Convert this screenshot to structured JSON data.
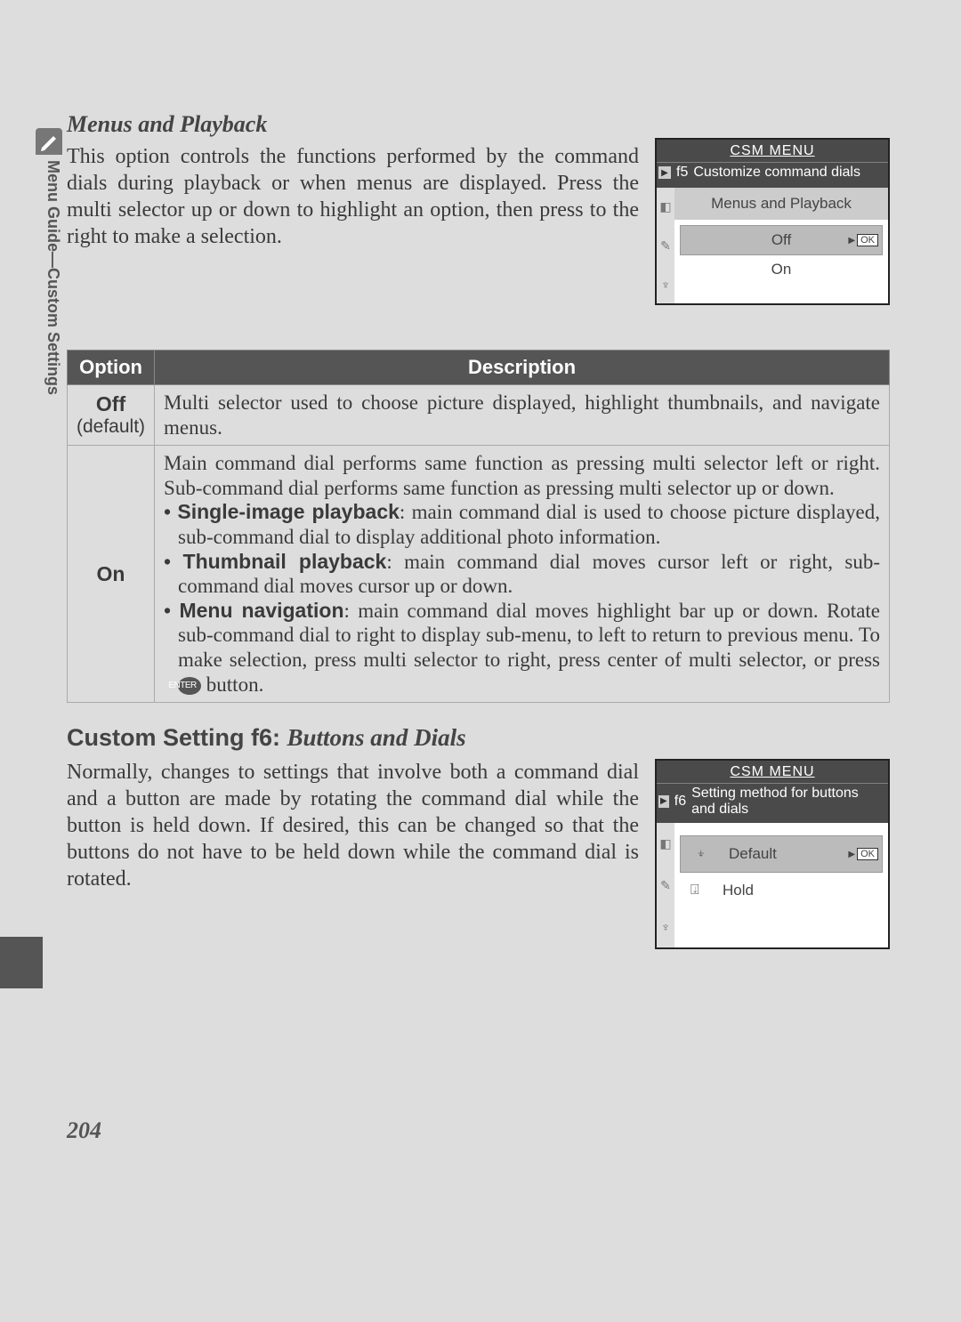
{
  "side_tab": {
    "label": "Menu Guide—Custom Settings"
  },
  "section1": {
    "subheading": "Menus and Playback",
    "body": "This option controls the functions performed by the command dials during playback or when menus are displayed.  Press the multi selector up or down to highlight an option, then press to the right to make a selection."
  },
  "lcd1": {
    "title": "CSM MENU",
    "setting_code": "f5",
    "setting_label": "Customize command dials",
    "menu_title": "Menus and Playback",
    "options": [
      {
        "label": "Off",
        "selected": true
      },
      {
        "label": "On",
        "selected": false
      }
    ],
    "ok": "OK"
  },
  "table": {
    "headers": {
      "option": "Option",
      "description": "Description"
    },
    "rows": [
      {
        "option": "Off",
        "default_text": "(default)",
        "description": "Multi selector used to choose picture displayed, highlight thumbnails, and navigate menus."
      },
      {
        "option": "On",
        "intro": "Main command dial performs same function as pressing multi selector left or right.  Sub-command dial performs same function as pressing multi selector up or down.",
        "bullets": [
          {
            "head": "Single-image playback",
            "text": ": main command dial is used to choose picture displayed, sub-command dial to display additional photo information."
          },
          {
            "head": "Thumbnail playback",
            "text": ": main command dial moves cursor left or right, sub-command dial moves cursor up or down."
          },
          {
            "head": "Menu navigation",
            "text_before": ": main command dial moves highlight bar up or down. Rotate sub-command dial to right to display sub-menu, to left to return to previous menu.  To make selection, press multi selector to right, press center of multi selector, or press ",
            "icon": "ENTER",
            "text_after": " button."
          }
        ]
      }
    ]
  },
  "section2": {
    "title_prefix": "Custom Setting f6: ",
    "title_italic": "Buttons and Dials",
    "body": "Normally, changes to settings that involve both a command dial and a button are made by rotating the command dial while the button is held down. If desired, this can be changed so that the buttons do not have to be held down while the command dial is rotated."
  },
  "lcd2": {
    "title": "CSM MENU",
    "setting_code": "f6",
    "setting_label": "Setting method for buttons and dials",
    "options": [
      {
        "label": "Default",
        "selected": true
      },
      {
        "label": "Hold",
        "selected": false
      }
    ],
    "ok": "OK"
  },
  "page_number": "204"
}
